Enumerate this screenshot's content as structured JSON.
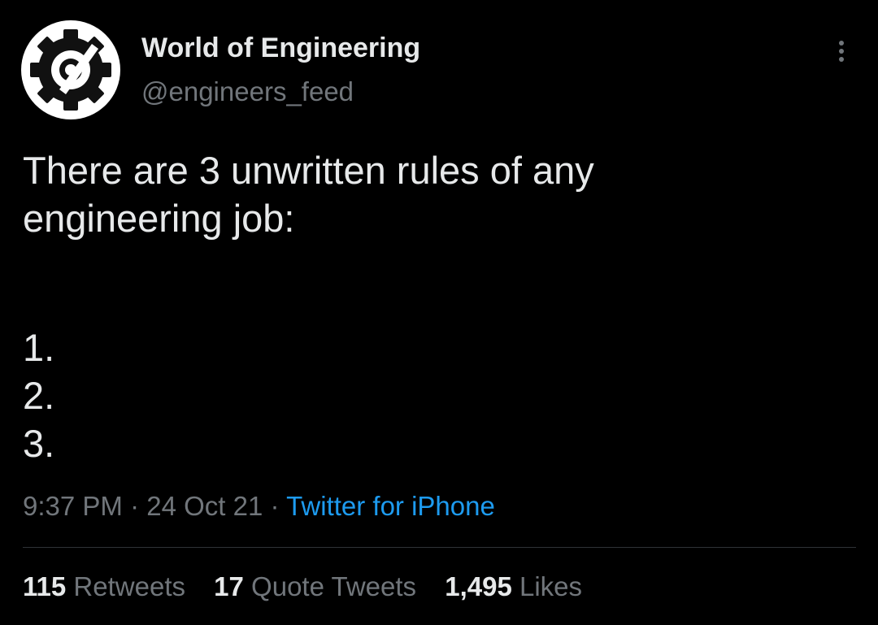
{
  "tweet": {
    "author": {
      "display_name": "World of Engineering",
      "handle": "@engineers_feed",
      "avatar_icon": "gear-logo-icon"
    },
    "more_icon": "more-vertical-icon",
    "text_lines": [
      "There are 3 unwritten rules of any",
      "engineering job:"
    ],
    "list_items": [
      "1.",
      "2.",
      "3."
    ],
    "meta": {
      "time": "9:37 PM",
      "separator": " · ",
      "date": "24 Oct 21",
      "source": "Twitter for iPhone"
    },
    "stats": [
      {
        "count": "115",
        "label": "Retweets"
      },
      {
        "count": "17",
        "label": "Quote Tweets"
      },
      {
        "count": "1,495",
        "label": "Likes"
      }
    ]
  },
  "colors": {
    "background": "#000000",
    "text_primary": "#e7e9ea",
    "text_secondary": "#71767b",
    "link": "#1d9bf0",
    "divider": "#2f3336"
  }
}
